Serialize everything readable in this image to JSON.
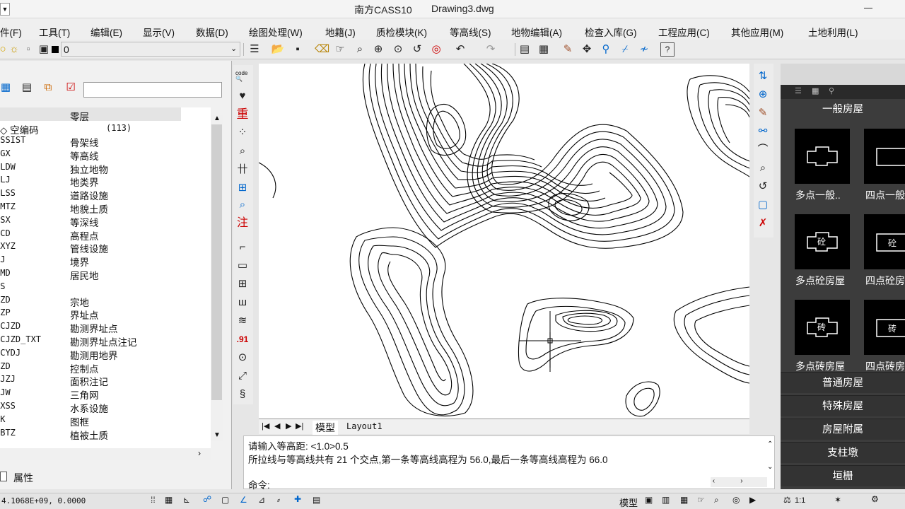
{
  "window": {
    "title": "南方CASS10",
    "document": "Drawing3.dwg"
  },
  "menu": [
    "件(F)",
    "工具(T)",
    "编辑(E)",
    "显示(V)",
    "数据(D)",
    "绘图处理(W)",
    "地籍(J)",
    "质检模块(K)",
    "等高线(S)",
    "地物编辑(A)",
    "检查入库(G)",
    "工程应用(C)",
    "其他应用(M)",
    "土地利用(L)"
  ],
  "toolbar": {
    "layer_value": "0"
  },
  "layers": {
    "header": "零层",
    "group": {
      "label": "◇ 空编码",
      "count": "(113)"
    },
    "rows": [
      {
        "code": "ASSIST",
        "name": "骨架线"
      },
      {
        "code": "DGX",
        "name": "等高线"
      },
      {
        "code": "DLDW",
        "name": "独立地物"
      },
      {
        "code": "DLJ",
        "name": "地类界"
      },
      {
        "code": "DLSS",
        "name": "道路设施"
      },
      {
        "code": "DMTZ",
        "name": "地貌土质"
      },
      {
        "code": "DSX",
        "name": "等深线"
      },
      {
        "code": "GCD",
        "name": "高程点"
      },
      {
        "code": "GXYZ",
        "name": "管线设施"
      },
      {
        "code": "JJ",
        "name": "境界"
      },
      {
        "code": "JMD",
        "name": "居民地"
      },
      {
        "code": "JS",
        "name": ""
      },
      {
        "code": "JZD",
        "name": "宗地"
      },
      {
        "code": "JZP",
        "name": "界址点"
      },
      {
        "code": "KCJZD",
        "name": "勘测界址点"
      },
      {
        "code": "KCJZD_TXT",
        "name": "勘测界址点注记"
      },
      {
        "code": "KCYDJ",
        "name": "勘测用地界"
      },
      {
        "code": "KZD",
        "name": "控制点"
      },
      {
        "code": "MJZJ",
        "name": "面积注记"
      },
      {
        "code": "SJW",
        "name": "三角网"
      },
      {
        "code": "SXSS",
        "name": "水系设施"
      },
      {
        "code": "TK",
        "name": "图框"
      },
      {
        "code": "ZBTZ",
        "name": "植被土质"
      }
    ],
    "properties_tab": "属性"
  },
  "layout_tabs": [
    "模型",
    "Layout1"
  ],
  "command": {
    "line1": "请输入等高距: <1.0>0.5",
    "line2": "所拉线与等高线共有 21 个交点,第一条等高线高程为 56.0,最后一条等高线高程为 66.0",
    "prompt": "命令:"
  },
  "right_panel": {
    "section": "一般房屋",
    "tiles": [
      {
        "label": "多点一般..",
        "glyph": ""
      },
      {
        "label": "四点一般",
        "glyph": ""
      },
      {
        "label": "多点砼房屋",
        "glyph": "砼"
      },
      {
        "label": "四点砼房",
        "glyph": "砼"
      },
      {
        "label": "多点砖房屋",
        "glyph": "砖"
      },
      {
        "label": "四点砖房",
        "glyph": "砖"
      }
    ],
    "categories": [
      "普通房屋",
      "特殊房屋",
      "房屋附属",
      "支柱墩",
      "垣栅"
    ]
  },
  "status": {
    "coords": "4.1068E+09, 0.0000",
    "model_label": "模型",
    "scale": "1:1"
  }
}
